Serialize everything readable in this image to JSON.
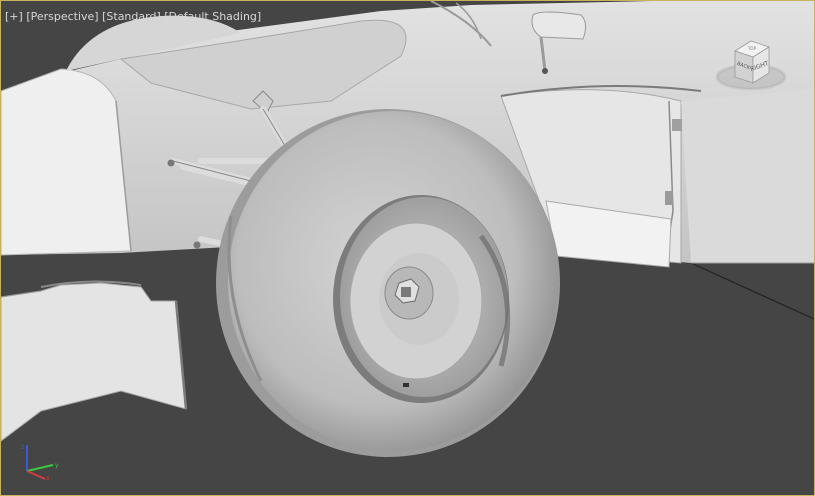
{
  "viewport": {
    "menu_plus": "[+]",
    "view_name": "[Perspective]",
    "view_mode": "[Standard]",
    "shading": "[Default Shading]"
  },
  "viewcube": {
    "face_label": "RIGHT",
    "side_label": "BACK",
    "top_label": "TOP"
  },
  "axis": {
    "x": "x",
    "y": "y",
    "z": "z"
  },
  "colors": {
    "viewport_bg": "#454545",
    "border_active": "#c8b25a",
    "axis_x": "#d23c3c",
    "axis_y": "#3cc83c",
    "axis_z": "#3c5ad2"
  }
}
